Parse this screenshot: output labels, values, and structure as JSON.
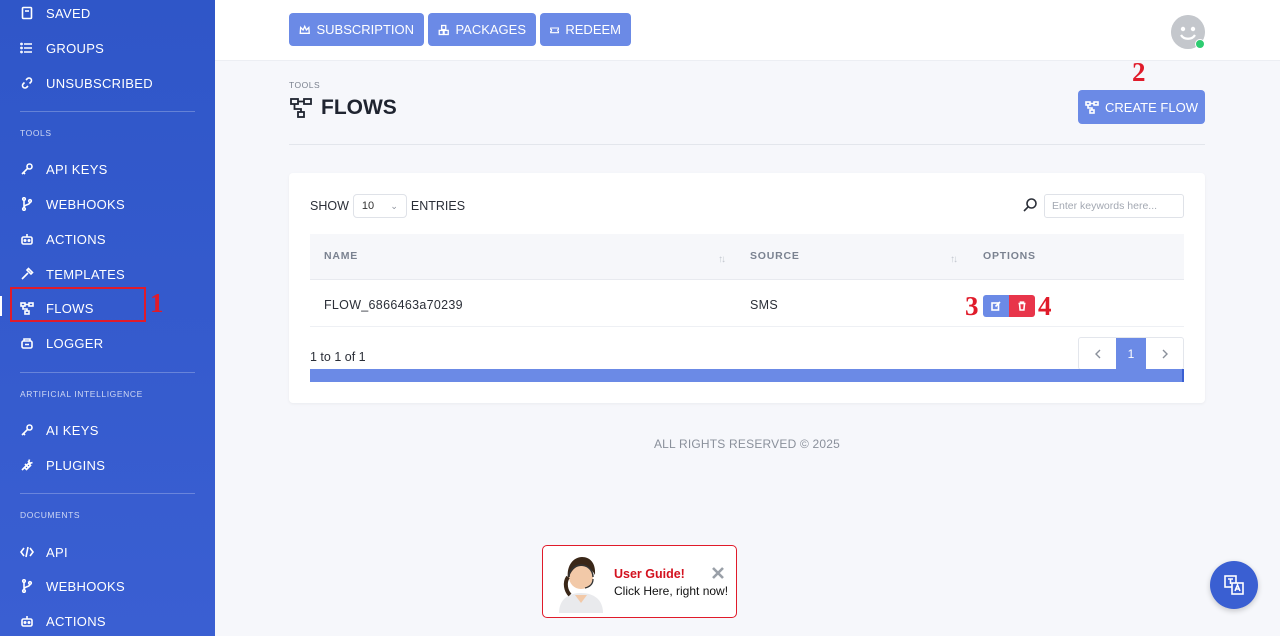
{
  "sidebar": {
    "items_top": [
      {
        "label": "SAVED",
        "icon": "bookmark-icon"
      },
      {
        "label": "GROUPS",
        "icon": "list-icon"
      },
      {
        "label": "UNSUBSCRIBED",
        "icon": "unlink-icon"
      }
    ],
    "tools_heading": "TOOLS",
    "tools_items": [
      {
        "label": "API KEYS",
        "icon": "key-icon"
      },
      {
        "label": "WEBHOOKS",
        "icon": "branch-icon"
      },
      {
        "label": "ACTIONS",
        "icon": "robot-icon"
      },
      {
        "label": "TEMPLATES",
        "icon": "hammer-icon"
      },
      {
        "label": "FLOWS",
        "icon": "flow-icon"
      },
      {
        "label": "LOGGER",
        "icon": "logger-icon"
      }
    ],
    "ai_heading": "ARTIFICIAL INTELLIGENCE",
    "ai_items": [
      {
        "label": "AI KEYS",
        "icon": "key-icon"
      },
      {
        "label": "PLUGINS",
        "icon": "plug-icon"
      }
    ],
    "docs_heading": "DOCUMENTS",
    "docs_items": [
      {
        "label": "API",
        "icon": "code-icon"
      },
      {
        "label": "WEBHOOKS",
        "icon": "branch-icon"
      },
      {
        "label": "ACTIONS",
        "icon": "robot-icon"
      }
    ]
  },
  "topbar": {
    "subscription": "SUBSCRIPTION",
    "packages": "PACKAGES",
    "redeem": "REDEEM"
  },
  "header": {
    "breadcrumb": "TOOLS",
    "title": "FLOWS",
    "create_label": "CREATE FLOW"
  },
  "callouts": [
    "1",
    "2",
    "3",
    "4"
  ],
  "table": {
    "show_label": "SHOW",
    "entries_value": "10",
    "entries_label": "ENTRIES",
    "search_placeholder": "Enter keywords here...",
    "columns": [
      "NAME",
      "SOURCE",
      "OPTIONS"
    ],
    "rows": [
      {
        "name": "FLOW_6866463a70239",
        "source": "SMS"
      }
    ],
    "info": "1 to 1 of 1",
    "current_page": "1"
  },
  "footer": "ALL RIGHTS RESERVED © 2025",
  "guide": {
    "title": "User Guide!",
    "subtitle": "Click Here, right now!"
  },
  "colors": {
    "sidebar": "#2f56c8",
    "accent": "#6b8ae6",
    "danger": "#e8354a",
    "callout": "#e01b2a"
  }
}
